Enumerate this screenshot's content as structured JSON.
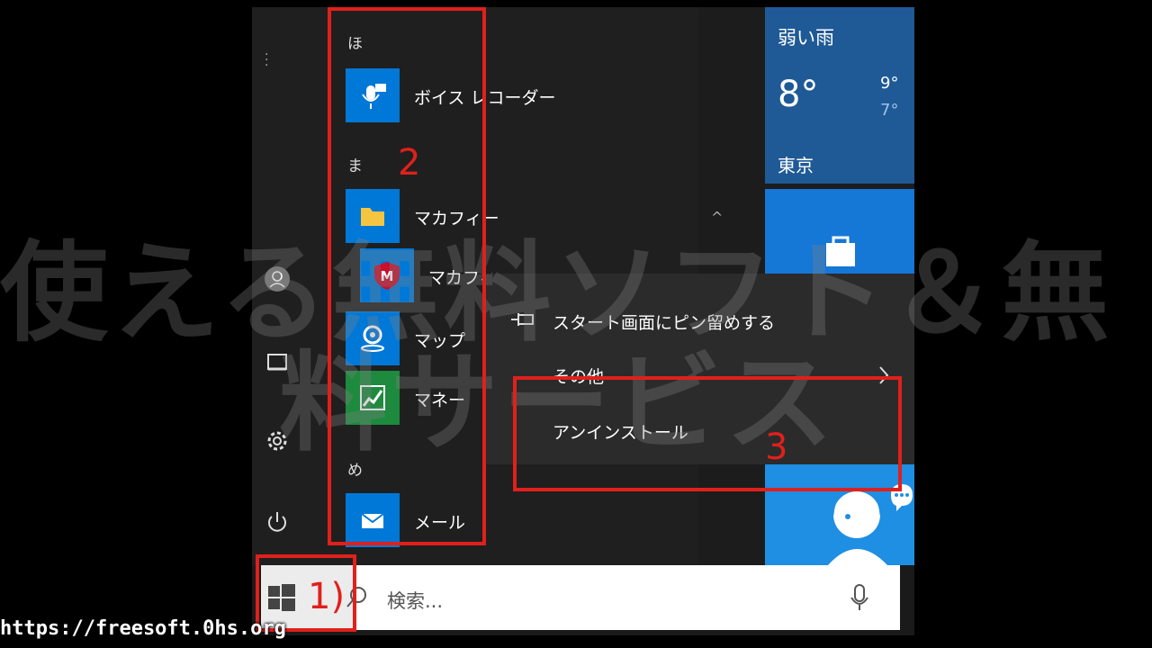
{
  "start_menu": {
    "sections": [
      {
        "letter": "ほ",
        "apps": [
          {
            "name": "ボイス レコーダー",
            "icon": "mic-icon"
          }
        ]
      },
      {
        "letter": "ま",
        "apps": [
          {
            "name": "マカフィー",
            "icon": "folder-icon"
          },
          {
            "name": "マカフィー",
            "icon": "mcafee-shield-icon"
          },
          {
            "name": "マップ",
            "icon": "map-pin-icon"
          },
          {
            "name": "マネー",
            "icon": "chart-icon"
          }
        ]
      },
      {
        "letter": "め",
        "apps": [
          {
            "name": "メール",
            "icon": "mail-icon"
          }
        ]
      }
    ]
  },
  "weather_tile": {
    "condition": "弱い雨",
    "temp": "8°",
    "high": "9°",
    "low": "7°",
    "city": "東京"
  },
  "context_menu": {
    "items": [
      {
        "label": "スタート画面にピン留めする",
        "icon": "pin-icon"
      },
      {
        "label": "その他",
        "icon": "chevron-right-icon"
      },
      {
        "label": "アンインストール",
        "icon": ""
      }
    ]
  },
  "taskbar": {
    "search_placeholder": "検索..."
  },
  "annotations": {
    "step1": "1)",
    "step2": "2",
    "step3": "3"
  },
  "watermark": {
    "line1": "使える無料ソフト＆無",
    "line2": "料サービス"
  },
  "site_url": "https://freesoft.0hs.org",
  "colors": {
    "accent_blue": "#0078d7",
    "annotation_red": "#e0201c",
    "weather_tile": "#1f5a96"
  }
}
